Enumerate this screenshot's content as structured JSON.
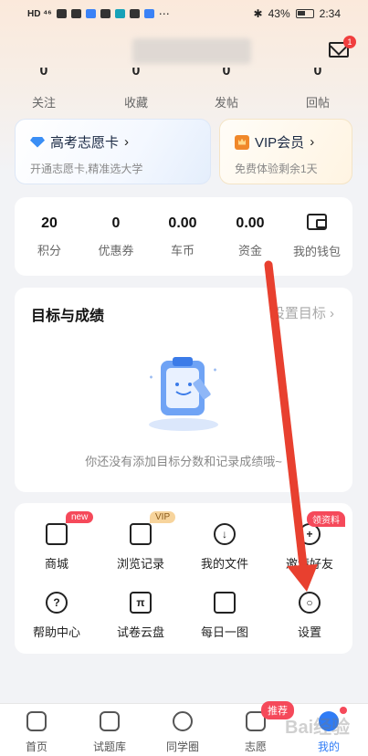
{
  "status_bar": {
    "left_indicators": "HD ⁴⁶",
    "battery": "43%",
    "time": "2:34"
  },
  "header": {
    "mail_badge": "1"
  },
  "top_stats": [
    {
      "value": "0",
      "label": "关注"
    },
    {
      "value": "0",
      "label": "收藏"
    },
    {
      "value": "0",
      "label": "发帖"
    },
    {
      "value": "0",
      "label": "回帖"
    }
  ],
  "promo_cards": {
    "gaokao": {
      "title": "高考志愿卡",
      "chevron": "›",
      "subtitle": "开通志愿卡,精准选大学"
    },
    "vip": {
      "title": "VIP会员",
      "chevron": "›",
      "subtitle": "免费体验剩余1天"
    }
  },
  "wallet": [
    {
      "value": "20",
      "label": "积分"
    },
    {
      "value": "0",
      "label": "优惠券"
    },
    {
      "value": "0.00",
      "label": "车币"
    },
    {
      "value": "0.00",
      "label": "资金"
    }
  ],
  "wallet_link": {
    "label": "我的钱包"
  },
  "goals": {
    "title": "目标与成绩",
    "set_label": "设置目标",
    "set_chevron": "›",
    "empty_text": "你还没有添加目标分数和记录成绩哦~"
  },
  "tools": [
    {
      "label": "商城",
      "tag": "new",
      "icon": "shop-icon"
    },
    {
      "label": "浏览记录",
      "tag": "VIP",
      "icon": "clipboard-history-icon"
    },
    {
      "label": "我的文件",
      "tag": "",
      "icon": "download-file-icon"
    },
    {
      "label": "邀请好友",
      "tag": "领资料",
      "icon": "add-friend-icon"
    },
    {
      "label": "帮助中心",
      "tag": "",
      "icon": "question-icon"
    },
    {
      "label": "试卷云盘",
      "tag": "",
      "icon": "pi-icon"
    },
    {
      "label": "每日一图",
      "tag": "",
      "icon": "image-icon"
    },
    {
      "label": "设置",
      "tag": "",
      "icon": "hexagon-settings-icon"
    }
  ],
  "tabbar": [
    {
      "label": "首页",
      "icon": "home-icon"
    },
    {
      "label": "试题库",
      "icon": "question-bank-icon"
    },
    {
      "label": "同学圈",
      "icon": "circle-icon"
    },
    {
      "label": "志愿",
      "icon": "cap-icon"
    },
    {
      "label": "我的",
      "icon": "profile-icon"
    }
  ],
  "tab_badge": "推荐",
  "colors": {
    "accent": "#2f7cf6",
    "badge": "#f5495a",
    "arrow": "#e8402f"
  }
}
